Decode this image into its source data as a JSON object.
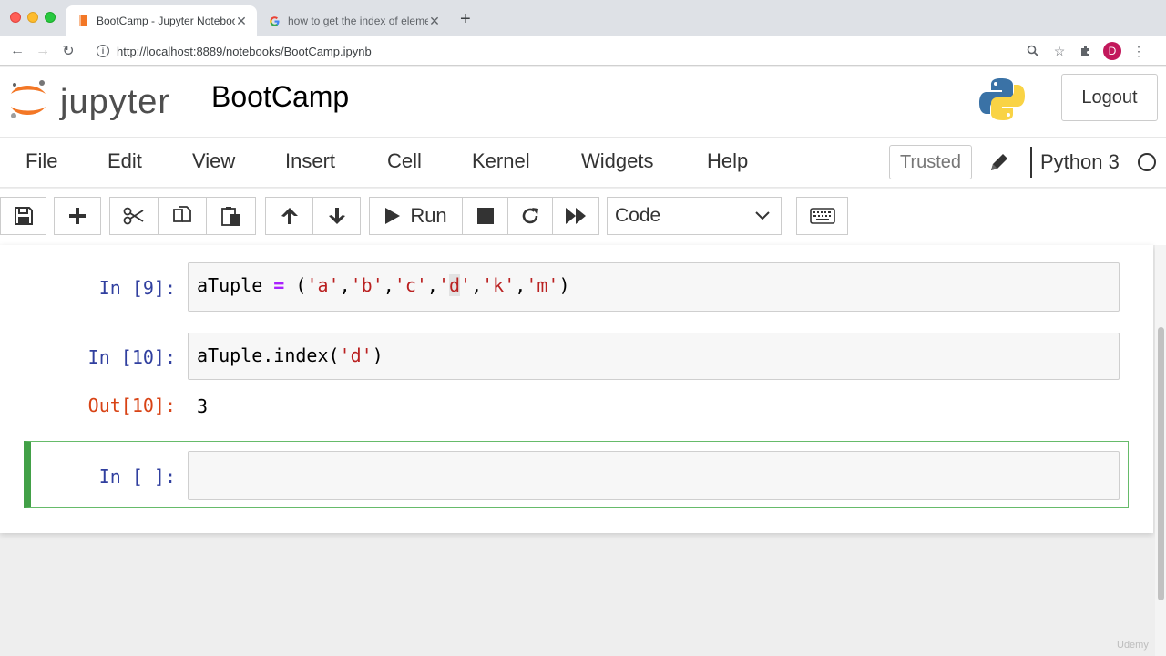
{
  "browser": {
    "tabs": [
      {
        "title": "BootCamp - Jupyter Notebook",
        "favicon": "jupyter-book-icon"
      },
      {
        "title": "how to get the index of elemen",
        "favicon": "google-icon"
      }
    ],
    "url": "http://localhost:8889/notebooks/BootCamp.ipynb",
    "profile_initial": "D"
  },
  "header": {
    "logo_text": "jupyter",
    "notebook_name": "BootCamp",
    "logout_label": "Logout"
  },
  "menu": {
    "items": [
      "File",
      "Edit",
      "View",
      "Insert",
      "Cell",
      "Kernel",
      "Widgets",
      "Help"
    ],
    "trusted_label": "Trusted",
    "kernel_name": "Python 3"
  },
  "toolbar": {
    "run_label": "Run",
    "cell_type": "Code"
  },
  "cells": [
    {
      "prompt": "In [9]:",
      "code": "aTuple = ('a','b','c','d','k','m')"
    },
    {
      "prompt": "In [10]:",
      "code": "aTuple.index('d')",
      "out_prompt": "Out[10]:",
      "output": "3"
    },
    {
      "prompt": "In [ ]:",
      "code": ""
    }
  ],
  "watermark": "Udemy",
  "colors": {
    "in_prompt": "#303f9f",
    "out_prompt": "#d84315",
    "selected_cell_border": "#42a047",
    "code_string": "#ba2121",
    "code_operator": "#aa22ff"
  }
}
